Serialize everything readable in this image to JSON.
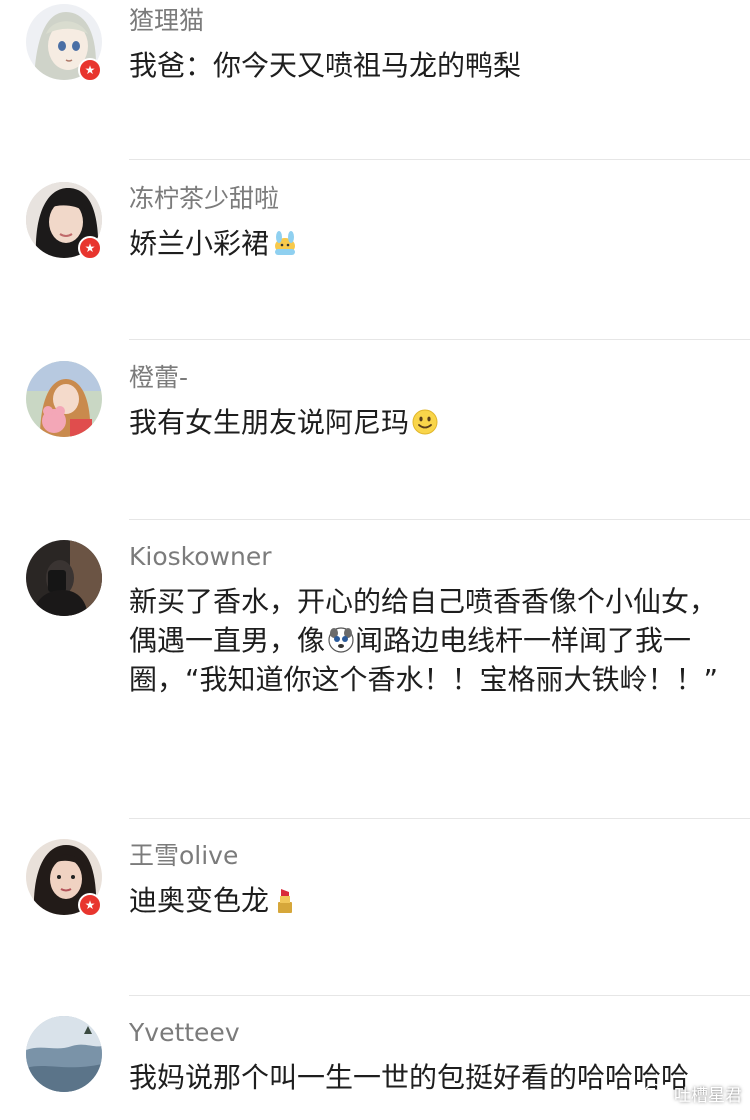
{
  "comments": [
    {
      "username": "猹理猫",
      "text": "我爸：你今天又喷祖马龙的鸭梨",
      "emoji": "",
      "avatar_desc": "anime-girl-avatar",
      "verified": true
    },
    {
      "username": "冻柠茶少甜啦",
      "text": "娇兰小彩裙",
      "emoji": "bunny-ears-emoji",
      "avatar_desc": "woman-selfie-avatar",
      "verified": true
    },
    {
      "username": "橙蕾-",
      "text": "我有女生朋友说阿尼玛",
      "emoji": "smile-emoji",
      "avatar_desc": "girl-with-plush-avatar",
      "verified": false
    },
    {
      "username": "Kioskowner",
      "text_part1": "新买了香水，开心的给自己喷香香像个小仙女，偶遇一直男，像",
      "text_part2": "闻路边电线杆一样闻了我一圈，“我知道你这个香水！！宝格丽大铁岭！！”",
      "emoji": "dog-face-emoji",
      "avatar_desc": "dark-photo-avatar",
      "verified": false
    },
    {
      "username": "王雪olive",
      "text": "迪奥变色龙",
      "emoji": "lipstick-emoji",
      "avatar_desc": "woman-portrait-avatar",
      "verified": true
    },
    {
      "username": "Yvetteev",
      "text": "我妈说那个叫一生一世的包挺好看的哈哈哈哈",
      "emoji": "",
      "avatar_desc": "landscape-avatar",
      "verified": false
    }
  ],
  "watermark": {
    "label": "吐槽星君",
    "icon": "wechat-official-account-icon"
  },
  "colors": {
    "username": "#7b7b7b",
    "text": "#1e1e1e",
    "divider": "#e6e6e6",
    "badge": "#e8352e"
  }
}
